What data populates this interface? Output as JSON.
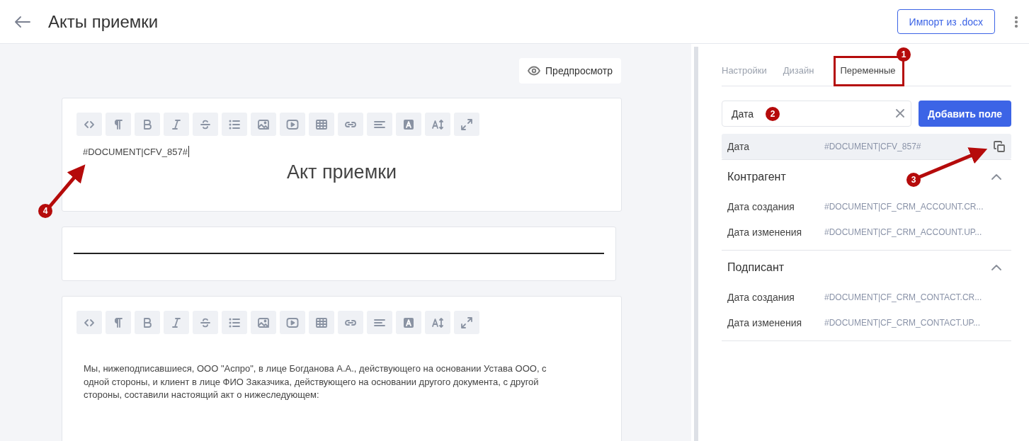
{
  "header": {
    "title": "Акты приемки",
    "import_button": "Импорт из .docx"
  },
  "preview_button": "Предпросмотр",
  "cards": [
    {
      "kind": "editor",
      "code_line": "#DOCUMENT|CFV_857#",
      "heading": "Акт приемки"
    },
    {
      "kind": "rule"
    },
    {
      "kind": "editor",
      "paragraph": "Мы, нижеподписавшиеся, ООО \"Аспро\", в лице Богданова А.А., действующего на основании Устава ООО, с одной стороны, и клиент в лице ФИО Заказчика, действующего на основании другого документа, с другой стороны, составили настоящий акт о нижеследующем:"
    }
  ],
  "tabs": [
    {
      "label": "Настройки",
      "selected": false
    },
    {
      "label": "Дизайн",
      "selected": false
    },
    {
      "label": "Переменные",
      "selected": true
    }
  ],
  "search": {
    "value": "Дата"
  },
  "add_button": "Добавить поле",
  "variables": [
    {
      "name": "Дата",
      "code": "#DOCUMENT|CFV_857#",
      "selected": true
    }
  ],
  "groups": [
    {
      "title": "Контрагент",
      "expanded": true,
      "items": [
        {
          "name": "Дата создания",
          "code": "#DOCUMENT|CF_CRM_ACCOUNT.CR...",
          "selected": false
        },
        {
          "name": "Дата изменения",
          "code": "#DOCUMENT|CF_CRM_ACCOUNT.UP...",
          "selected": false
        }
      ]
    },
    {
      "title": "Подписант",
      "expanded": true,
      "items": [
        {
          "name": "Дата создания",
          "code": "#DOCUMENT|CF_CRM_CONTACT.CR...",
          "selected": false
        },
        {
          "name": "Дата изменения",
          "code": "#DOCUMENT|CF_CRM_CONTACT.UP...",
          "selected": false
        }
      ]
    }
  ],
  "annotations": [
    {
      "label": "1"
    },
    {
      "label": "2"
    },
    {
      "label": "3"
    },
    {
      "label": "4"
    }
  ]
}
